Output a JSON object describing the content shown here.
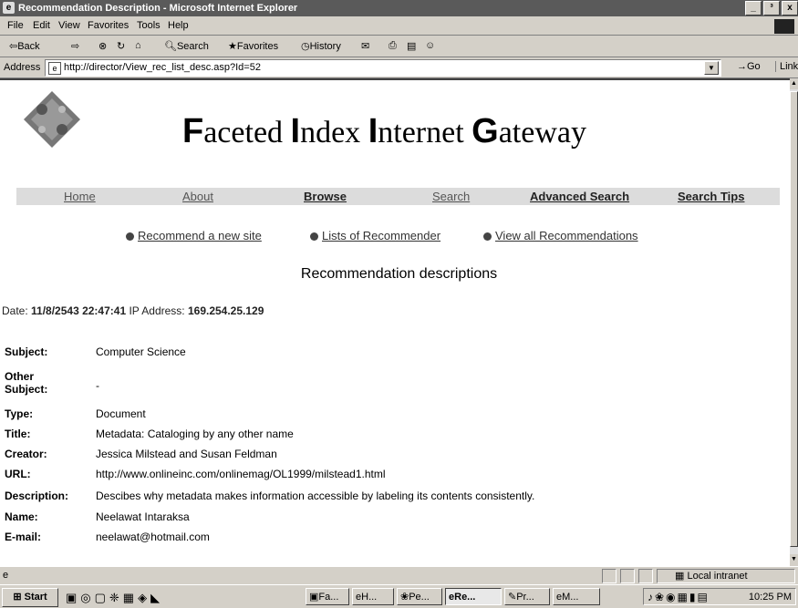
{
  "window": {
    "title": "Recommendation Description - Microsoft Internet Explorer",
    "buttons": [
      "_",
      "³",
      "x"
    ]
  },
  "menu": [
    "File",
    "Edit",
    "View",
    "Favorites",
    "Tools",
    "Help"
  ],
  "toolbar": {
    "back": "⇦Back",
    "forward": "⇨",
    "search": "Search",
    "favorites": "Favorites",
    "history": "History"
  },
  "address": {
    "label": "Address",
    "url": "http://director/View_rec_list_desc.asp?Id=52",
    "go": "Go",
    "links": "Links"
  },
  "site": {
    "title_parts": [
      {
        "cap": "F",
        "rest": "aceted "
      },
      {
        "cap": "I",
        "rest": "ndex "
      },
      {
        "cap": "I",
        "rest": "nternet "
      },
      {
        "cap": "G",
        "rest": "ateway"
      }
    ],
    "nav": [
      "Home",
      "About",
      "Browse",
      "Search",
      "Advanced Search",
      "Search Tips"
    ],
    "subnav": [
      "Recommend a new site",
      "Lists of Recommender",
      "View all Recommendations"
    ]
  },
  "page": {
    "heading": "Recommendation descriptions",
    "date_label": "Date:",
    "date_value": "11/8/2543 22:47:41",
    "ip_label": "IP Address:",
    "ip_value": "169.254.25.129",
    "fields": [
      {
        "label": "Subject:",
        "value": "Computer Science"
      },
      {
        "label": "Other Subject:",
        "value": "-"
      },
      {
        "label": "Type:",
        "value": "Document"
      },
      {
        "label": "Title:",
        "value": "Metadata: Cataloging by any other name"
      },
      {
        "label": "Creator:",
        "value": "Jessica Milstead and Susan Feldman"
      },
      {
        "label": "URL:",
        "value": "http://www.onlineinc.com/onlinemag/OL1999/milstead1.html"
      },
      {
        "label": "Description:",
        "value": "Descibes why metadata makes information accessible by labeling its contents consistently."
      },
      {
        "label": "Name:",
        "value": "Neelawat Intaraksa"
      },
      {
        "label": "E-mail:",
        "value": "neelawat@hotmail.com"
      }
    ]
  },
  "status": {
    "zone": "Local intranet"
  },
  "taskbar": {
    "start": "Start",
    "tasks": [
      "Fa...",
      "H...",
      "Pe...",
      "Re...",
      "Pr...",
      "M..."
    ],
    "active_task": 3,
    "clock": "10:25 PM"
  }
}
